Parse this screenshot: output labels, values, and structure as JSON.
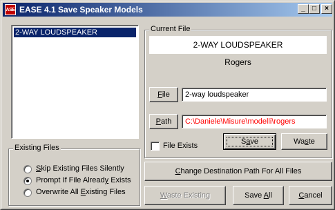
{
  "window": {
    "title": "EASE 4.1  Save Speaker Models",
    "app_icon": "EASE-logo-icon"
  },
  "speaker_list": {
    "items": [
      "2-WAY LOUDSPEAKER"
    ]
  },
  "current_file": {
    "group_label": "Current File",
    "name_display": "2-WAY LOUDSPEAKER",
    "author": "Rogers",
    "file_button": {
      "pre": "",
      "u": "F",
      "post": "ile"
    },
    "file_value": "2-way loudspeaker",
    "path_button": {
      "pre": "",
      "u": "P",
      "post": "ath"
    },
    "path_value": "C:\\Daniele\\Misure\\modelli\\rogers",
    "path_color": "#ff0000",
    "file_exists_label": "File Exists",
    "file_exists_checked": false,
    "save_button": {
      "pre": "S",
      "u": "a",
      "post": "ve"
    },
    "waste_button": {
      "pre": "Wa",
      "u": "s",
      "post": "te"
    }
  },
  "existing_files": {
    "group_label": "Existing Files",
    "options": [
      {
        "pre": "",
        "u": "S",
        "post": "kip Existing Files Silently",
        "selected": false
      },
      {
        "pre": "Prompt If File Alread",
        "u": "y",
        "post": " Exists",
        "selected": true
      },
      {
        "pre": "Overwrite All ",
        "u": "E",
        "post": "xisting Files",
        "selected": false
      }
    ]
  },
  "buttons": {
    "change_path": {
      "pre": "",
      "u": "C",
      "post": "hange Destination Path For All Files"
    },
    "waste_existing": {
      "pre": "",
      "u": "W",
      "post": "aste Existing"
    },
    "save_all": {
      "pre": "Save ",
      "u": "A",
      "post": "ll"
    },
    "cancel": {
      "pre": "",
      "u": "C",
      "post": "ancel"
    }
  },
  "colors": {
    "titlebar_start": "#0a246a",
    "titlebar_end": "#a6caf0",
    "face": "#d4d0c8",
    "selection": "#0a246a"
  }
}
